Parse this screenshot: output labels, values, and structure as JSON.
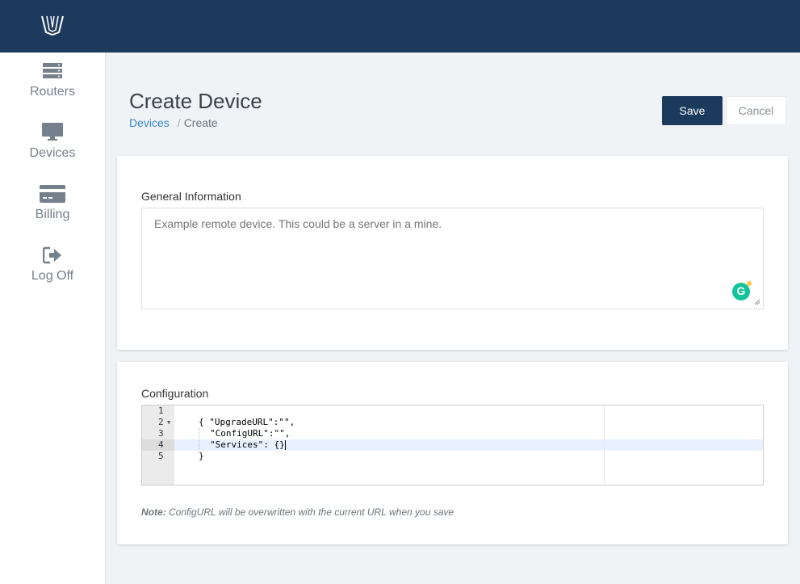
{
  "sidebar": {
    "items": [
      {
        "label": "Routers",
        "icon": "server-icon"
      },
      {
        "label": "Devices",
        "icon": "monitor-icon"
      },
      {
        "label": "Billing",
        "icon": "credit-card-icon"
      },
      {
        "label": "Log Off",
        "icon": "logout-icon"
      }
    ]
  },
  "header": {
    "title": "Create Device",
    "breadcrumb": {
      "link": "Devices",
      "separator": "/",
      "current": "Create"
    }
  },
  "actions": {
    "save_label": "Save",
    "cancel_label": "Cancel"
  },
  "general": {
    "label": "General Information",
    "placeholder": "Example remote device. This could be a server in a mine."
  },
  "config": {
    "label": "Configuration",
    "line_numbers": [
      "1",
      "2",
      "3",
      "4",
      "5"
    ],
    "lines": [
      "",
      "{ \"UpgradeURL\":\"\",",
      "\"ConfigURL\":\"\",",
      "\"Services\": {}",
      "}"
    ],
    "note_bold": "Note:",
    "note_text": " ConfigURL will be overwritten with the current URL when you save"
  },
  "colors": {
    "topbar": "#1b3a5c",
    "primary_button": "#1b3a5c",
    "link": "#3b86d1",
    "grammarly": "#15c39a"
  }
}
